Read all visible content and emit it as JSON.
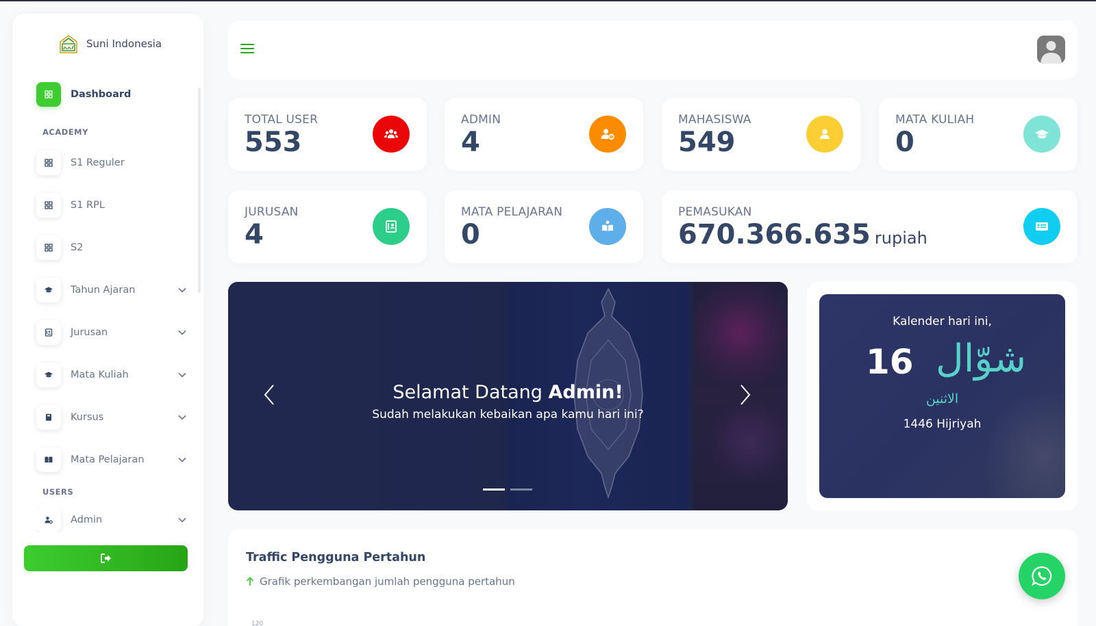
{
  "brand": {
    "name": "Suni Indonesia"
  },
  "sidebar": {
    "dashboard": {
      "label": "Dashboard",
      "icon": "grid-icon"
    },
    "sections": {
      "academy": "ACADEMY",
      "users": "USERS"
    },
    "items": [
      {
        "label": "S1 Reguler",
        "icon": "grid-icon",
        "expandable": false
      },
      {
        "label": "S1 RPL",
        "icon": "grid-icon",
        "expandable": false
      },
      {
        "label": "S2",
        "icon": "grid-icon",
        "expandable": false
      },
      {
        "label": "Tahun Ajaran",
        "icon": "graduation-cap-icon",
        "expandable": true
      },
      {
        "label": "Jurusan",
        "icon": "id-badge-icon",
        "expandable": true
      },
      {
        "label": "Mata Kuliah",
        "icon": "graduation-cap-icon",
        "expandable": true
      },
      {
        "label": "Kursus",
        "icon": "book-icon",
        "expandable": true
      },
      {
        "label": "Mata Pelajaran",
        "icon": "open-book-icon",
        "expandable": true
      }
    ],
    "users_items": [
      {
        "label": "Admin",
        "icon": "user-gear-icon",
        "expandable": true
      }
    ],
    "logout_icon": "sign-out-icon",
    "accent": "#3ecc32"
  },
  "stats": {
    "total_user": {
      "label": "TOTAL USER",
      "value": "553",
      "color": "#ea0606",
      "icon": "users-icon"
    },
    "admin": {
      "label": "ADMIN",
      "value": "4",
      "color": "#fb8c00",
      "icon": "user-gear-icon"
    },
    "mahasiswa": {
      "label": "MAHASISWA",
      "value": "549",
      "color": "#fbcf33",
      "icon": "user-icon"
    },
    "mata_kuliah": {
      "label": "MATA KULIAH",
      "value": "0",
      "color": "#7fe3d6",
      "icon": "graduation-cap-icon"
    },
    "jurusan": {
      "label": "JURUSAN",
      "value": "4",
      "color": "#2dce89",
      "icon": "id-badge-icon"
    },
    "mata_pelajaran": {
      "label": "MATA PELAJARAN",
      "value": "0",
      "color": "#5eaee9",
      "icon": "book-reader-icon"
    },
    "pemasukan": {
      "label": "PEMASUKAN",
      "value": "670.366.635",
      "unit": "rupiah",
      "color": "#11cdef",
      "icon": "money-card-icon"
    }
  },
  "carousel": {
    "title_prefix": "Selamat Datang",
    "title_name": "Admin!",
    "subtitle": "Sudah melakukan kebaikan apa kamu hari ini?",
    "slide_count": 2,
    "active_slide": 1
  },
  "calendar": {
    "title": "Kalender hari ini,",
    "day": "16",
    "month": "شوّال",
    "weekday": "الاثنين",
    "year": "1446 Hijriyah"
  },
  "traffic": {
    "title": "Traffic Pengguna Pertahun",
    "subtitle": "Grafik perkembangan jumlah pengguna pertahun",
    "axis_top_tick": "120"
  },
  "whatsapp": {
    "icon": "whatsapp-icon"
  }
}
